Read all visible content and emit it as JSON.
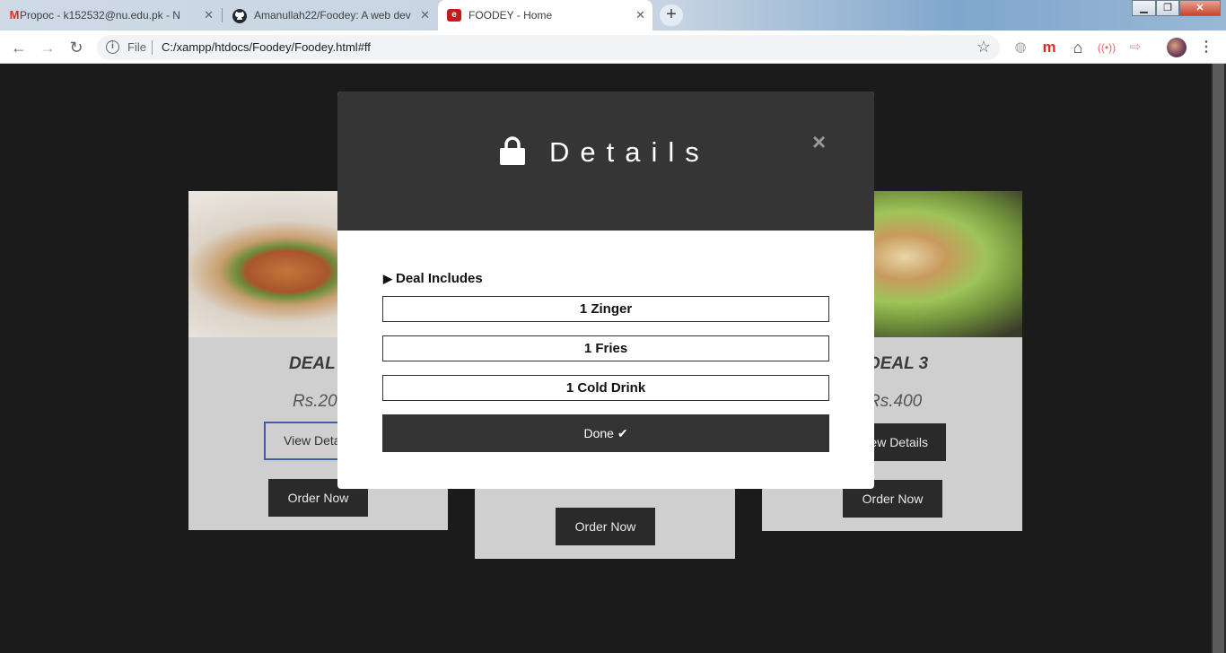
{
  "browser": {
    "tabs": [
      {
        "title": "Propoc - k152532@nu.edu.pk - N",
        "icon": "gmail-icon"
      },
      {
        "title": "Amanullah22/Foodey: A web dev",
        "icon": "github-icon"
      },
      {
        "title": "FOODEY - Home",
        "icon": "foodey-icon"
      }
    ],
    "address": {
      "scheme_label": "File",
      "url": "C:/xampp/htdocs/Foodey/Foodey.html#ff"
    }
  },
  "cards": [
    {
      "title": "DEAL",
      "price": "Rs.20",
      "details_label": "View Deta",
      "order_label": "Order Now"
    },
    {
      "title": "",
      "price": "",
      "details_label": "",
      "order_label": "Order Now"
    },
    {
      "title": "DEAL 3",
      "price": "Rs.400",
      "details_label": "ew Details",
      "order_label": "Order Now"
    }
  ],
  "modal": {
    "title": "Details",
    "close": "×",
    "section_label": "Deal Includes",
    "items": [
      "1 Zinger",
      "1 Fries",
      "1 Cold Drink"
    ],
    "done_label": "Done"
  },
  "colors": {
    "page_bg": "#1b1b1b",
    "modal_header": "#353535",
    "button_dark": "#2a2a2a",
    "outline_button_border": "#3b5ea6"
  }
}
